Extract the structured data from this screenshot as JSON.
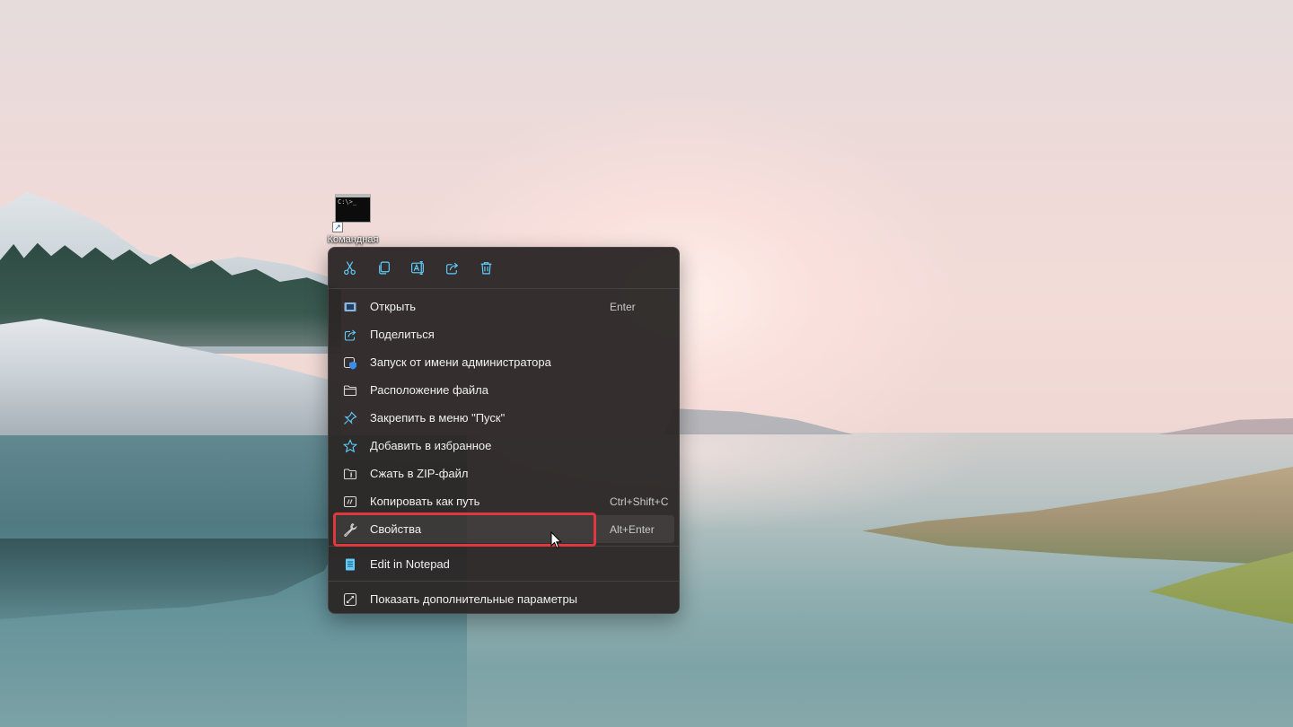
{
  "desktop": {
    "icon_label": "Командная",
    "icon_glyph": "C:\\>_",
    "icon_name": "command-prompt-icon"
  },
  "toolbar": [
    {
      "name": "cut",
      "icon": "scissors-icon"
    },
    {
      "name": "copy",
      "icon": "copy-icon"
    },
    {
      "name": "rename",
      "icon": "rename-icon"
    },
    {
      "name": "share",
      "icon": "share-icon"
    },
    {
      "name": "delete",
      "icon": "trash-icon"
    }
  ],
  "menu": {
    "items": [
      {
        "label": "Открыть",
        "shortcut": "Enter",
        "icon": "open-window-icon"
      },
      {
        "label": "Поделиться",
        "shortcut": "",
        "icon": "share-icon"
      },
      {
        "label": "Запуск от имени администратора",
        "shortcut": "",
        "icon": "admin-shield-icon"
      },
      {
        "label": "Расположение файла",
        "shortcut": "",
        "icon": "folder-icon"
      },
      {
        "label": "Закрепить в меню \"Пуск\"",
        "shortcut": "",
        "icon": "pin-icon"
      },
      {
        "label": "Добавить в избранное",
        "shortcut": "",
        "icon": "star-icon"
      },
      {
        "label": "Сжать в ZIP-файл",
        "shortcut": "",
        "icon": "zip-folder-icon"
      },
      {
        "label": "Копировать как путь",
        "shortcut": "Ctrl+Shift+C",
        "icon": "copy-path-icon"
      },
      {
        "label": "Свойства",
        "shortcut": "Alt+Enter",
        "icon": "wrench-icon"
      }
    ],
    "notepad_item": {
      "label": "Edit in Notepad",
      "icon": "notepad-icon"
    },
    "more_item": {
      "label": "Показать дополнительные параметры",
      "icon": "more-options-icon"
    }
  },
  "colors": {
    "menu_bg": "#2c2826",
    "accent_icon": "#60cdff",
    "highlight": "#e0383e"
  }
}
